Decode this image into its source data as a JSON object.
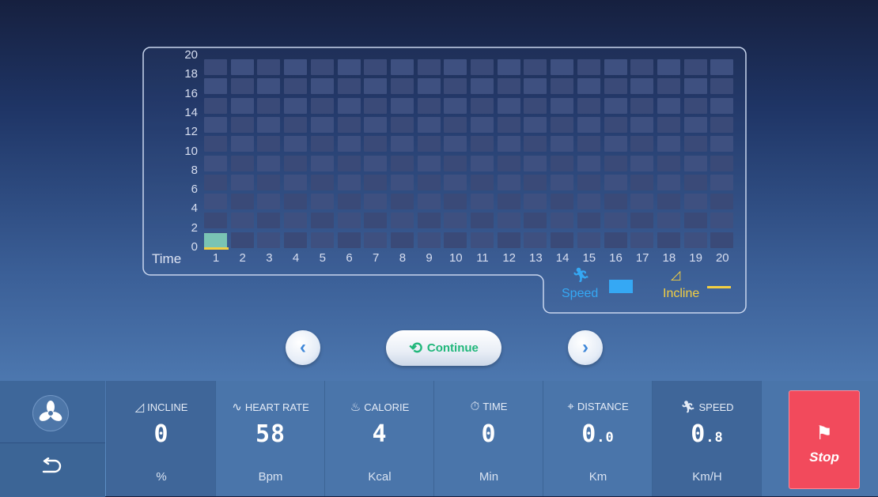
{
  "chart": {
    "y_ticks": [
      "20",
      "18",
      "16",
      "14",
      "12",
      "10",
      "8",
      "6",
      "4",
      "2",
      "0"
    ],
    "x_ticks": [
      "1",
      "2",
      "3",
      "4",
      "5",
      "6",
      "7",
      "8",
      "9",
      "10",
      "11",
      "12",
      "13",
      "14",
      "15",
      "16",
      "17",
      "18",
      "19",
      "20"
    ],
    "time_label": "Time",
    "speed_color": "#35a8f4",
    "incline_color": "#f3cf42"
  },
  "chart_data": {
    "type": "bar",
    "xlabel": "Time",
    "categories": [
      "1",
      "2",
      "3",
      "4",
      "5",
      "6",
      "7",
      "8",
      "9",
      "10",
      "11",
      "12",
      "13",
      "14",
      "15",
      "16",
      "17",
      "18",
      "19",
      "20"
    ],
    "ylim": [
      0,
      20
    ],
    "series": [
      {
        "name": "Speed",
        "values": [
          1.6,
          0,
          0,
          0,
          0,
          0,
          0,
          0,
          0,
          0,
          0,
          0,
          0,
          0,
          0,
          0,
          0,
          0,
          0,
          0
        ]
      },
      {
        "name": "Incline",
        "values": [
          0,
          0,
          0,
          0,
          0,
          0,
          0,
          0,
          0,
          0,
          0,
          0,
          0,
          0,
          0,
          0,
          0,
          0,
          0,
          0
        ]
      }
    ],
    "legend": "bottom-right",
    "grid": true
  },
  "legend": {
    "speed_label": "Speed",
    "incline_label": "Incline"
  },
  "nav": {
    "continue_label": "Continue"
  },
  "stats": {
    "incline": {
      "label": "INCLINE",
      "value": "0",
      "unit": "%"
    },
    "heart_rate": {
      "label": "HEART RATE",
      "value": "58",
      "unit": "Bpm"
    },
    "calorie": {
      "label": "CALORIE",
      "value": "4",
      "unit": "Kcal"
    },
    "time": {
      "label": "TIME",
      "value": "0",
      "unit": "Min"
    },
    "distance": {
      "label": "DISTANCE",
      "value_int": "0",
      "value_dec": ".0",
      "unit": "Km"
    },
    "speed": {
      "label": "SPEED",
      "value_int": "0",
      "value_dec": ".8",
      "unit": "Km/H"
    }
  },
  "stop": {
    "label": "Stop"
  }
}
